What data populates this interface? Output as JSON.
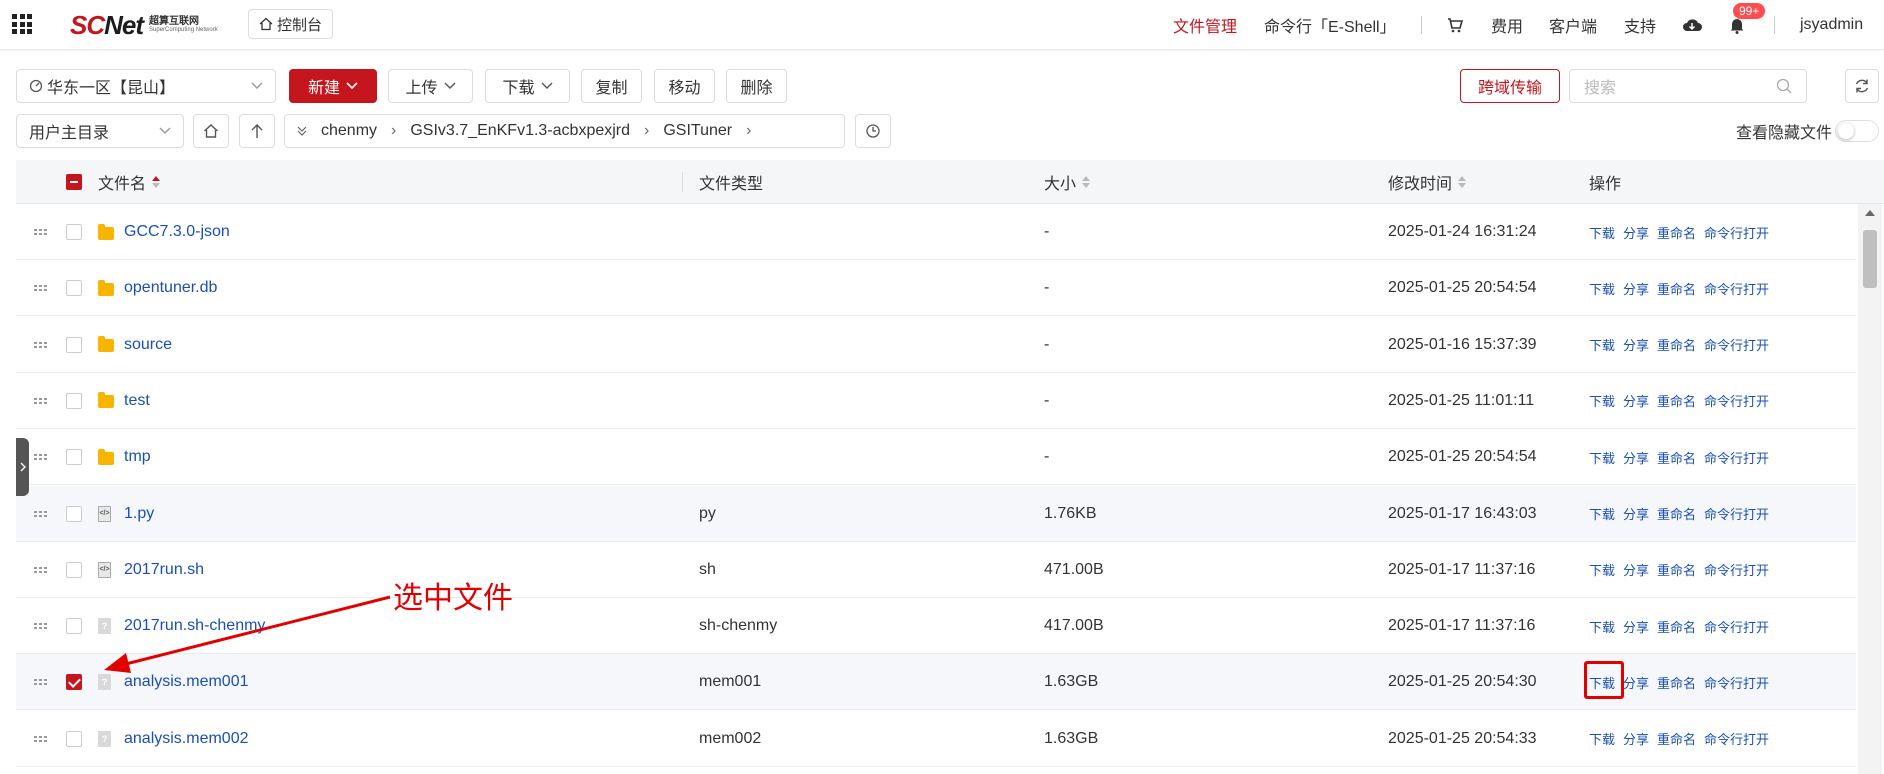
{
  "header": {
    "logo_brand": "SCNet",
    "logo_cn": "超算互联网",
    "logo_en": "SuperComputing Network",
    "console": "控制台",
    "nav": [
      "文件管理",
      "命令行「E-Shell」",
      "费用",
      "客户端",
      "支持"
    ],
    "badge": "99+",
    "user": "jsyadmin",
    "colors": {
      "accent": "#c4161c",
      "link": "#1a4fb8"
    }
  },
  "toolbar": {
    "region": "华东一区【昆山】",
    "new": "新建",
    "upload": "上传",
    "download": "下载",
    "copy": "复制",
    "move": "移动",
    "delete": "删除",
    "transfer": "跨域传输",
    "search_placeholder": "搜索"
  },
  "pathbar": {
    "root": "用户主目录",
    "crumbs": [
      "chenmy",
      "GSIv3.7_EnKFv1.3-acbxpexjrd",
      "GSITuner"
    ],
    "show_hidden": "查看隐藏文件"
  },
  "table": {
    "headers": {
      "name": "文件名",
      "type": "文件类型",
      "size": "大小",
      "mtime": "修改时间",
      "ops": "操作"
    },
    "ops": [
      "下载",
      "分享",
      "重命名",
      "命令行打开"
    ],
    "rows": [
      {
        "name": "GCC7.3.0-json",
        "type": "",
        "size": "-",
        "mtime": "2025-01-24 16:31:24",
        "kind": "folder"
      },
      {
        "name": "opentuner.db",
        "type": "",
        "size": "-",
        "mtime": "2025-01-25 20:54:54",
        "kind": "folder"
      },
      {
        "name": "source",
        "type": "",
        "size": "-",
        "mtime": "2025-01-16 15:37:39",
        "kind": "folder"
      },
      {
        "name": "test",
        "type": "",
        "size": "-",
        "mtime": "2025-01-25 11:01:11",
        "kind": "folder"
      },
      {
        "name": "tmp",
        "type": "",
        "size": "-",
        "mtime": "2025-01-25 20:54:54",
        "kind": "folder"
      },
      {
        "name": "1.py",
        "type": "py",
        "size": "1.76KB",
        "mtime": "2025-01-17 16:43:03",
        "kind": "code"
      },
      {
        "name": "2017run.sh",
        "type": "sh",
        "size": "471.00B",
        "mtime": "2025-01-17 11:37:16",
        "kind": "code"
      },
      {
        "name": "2017run.sh-chenmy",
        "type": "sh-chenmy",
        "size": "417.00B",
        "mtime": "2025-01-17 11:37:16",
        "kind": "unknown"
      },
      {
        "name": "analysis.mem001",
        "type": "mem001",
        "size": "1.63GB",
        "mtime": "2025-01-25 20:54:30",
        "kind": "unknown",
        "selected": true
      },
      {
        "name": "analysis.mem002",
        "type": "mem002",
        "size": "1.63GB",
        "mtime": "2025-01-25 20:54:33",
        "kind": "unknown"
      }
    ]
  },
  "annotation": {
    "text": "选中文件"
  }
}
